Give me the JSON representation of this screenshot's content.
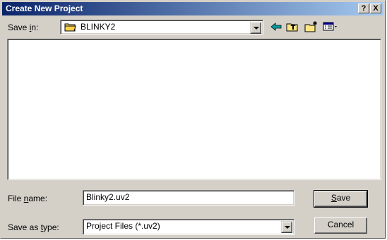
{
  "window": {
    "title": "Create New Project",
    "help_button": "?",
    "close_button": "X"
  },
  "save_in": {
    "label_pre": "Save ",
    "label_key": "i",
    "label_post": "n:",
    "value": "BLINKY2"
  },
  "toolbar": {
    "back_icon": "back-arrow-icon",
    "up_icon": "up-folder-icon",
    "new_folder_icon": "new-folder-icon",
    "view_menu_icon": "view-menu-icon"
  },
  "file_name": {
    "label_key": "F",
    "label_pre": "File ",
    "label_mid": "n",
    "label_post": "ame:",
    "value": "Blinky2.uv2"
  },
  "save_as_type": {
    "label_pre": "Save as ",
    "label_key": "t",
    "label_post": "ype:",
    "value": "Project Files (*.uv2)"
  },
  "buttons": {
    "save_key": "S",
    "save_rest": "ave",
    "cancel": "Cancel"
  },
  "colors": {
    "title_start": "#0a246a",
    "title_end": "#a6caf0",
    "face": "#d4d0c8"
  }
}
